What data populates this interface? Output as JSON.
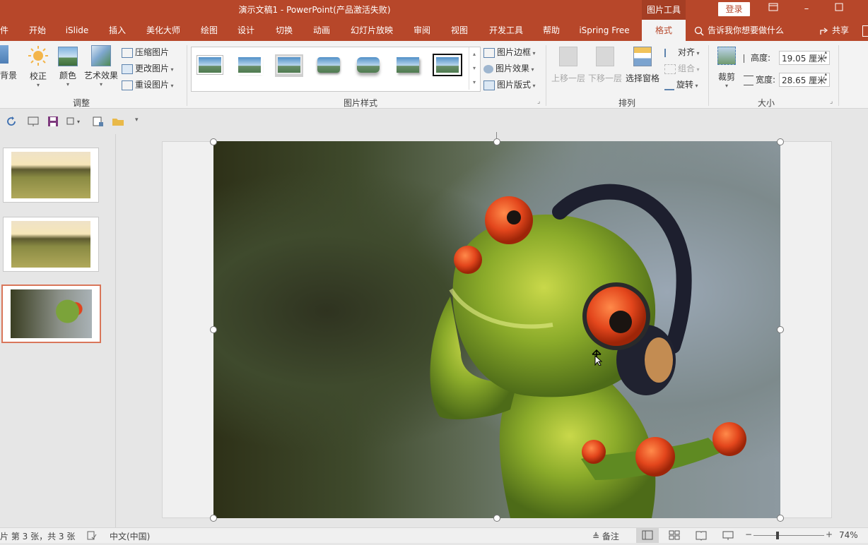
{
  "titlebar": {
    "doc_title": "演示文稿1  -  PowerPoint(产品激活失败)",
    "context_label": "图片工具",
    "login": "登录"
  },
  "tabs": [
    {
      "label": "件"
    },
    {
      "label": "开始"
    },
    {
      "label": "iSlide"
    },
    {
      "label": "插入"
    },
    {
      "label": "美化大师"
    },
    {
      "label": "绘图"
    },
    {
      "label": "设计"
    },
    {
      "label": "切换"
    },
    {
      "label": "动画"
    },
    {
      "label": "幻灯片放映"
    },
    {
      "label": "审阅"
    },
    {
      "label": "视图"
    },
    {
      "label": "开发工具"
    },
    {
      "label": "帮助"
    },
    {
      "label": "iSpring Free"
    },
    {
      "label": "格式",
      "active": true
    }
  ],
  "tell_me": "告诉我你想要做什么",
  "share": "共享",
  "ribbon": {
    "adjust": {
      "remove_bg": "背景",
      "corrections": "校正",
      "color": "颜色",
      "artistic": "艺术效果",
      "compress": "压缩图片",
      "change": "更改图片",
      "reset": "重设图片",
      "group_label": "调整"
    },
    "styles": {
      "border": "图片边框",
      "effects": "图片效果",
      "layout": "图片版式",
      "group_label": "图片样式"
    },
    "arrange": {
      "bring_forward": "上移一层",
      "send_backward": "下移一层",
      "selection_pane": "选择窗格",
      "align": "对齐",
      "group": "组合",
      "rotate": "旋转",
      "group_label": "排列"
    },
    "size": {
      "crop": "裁剪",
      "height_label": "高度:",
      "height_value": "19.05 厘米",
      "width_label": "宽度:",
      "width_value": "28.65 厘米",
      "group_label": "大小"
    }
  },
  "status": {
    "slide_info": "片 第 3 张，共 3 张",
    "language": "中文(中国)",
    "notes": "备注",
    "zoom": "74%"
  }
}
